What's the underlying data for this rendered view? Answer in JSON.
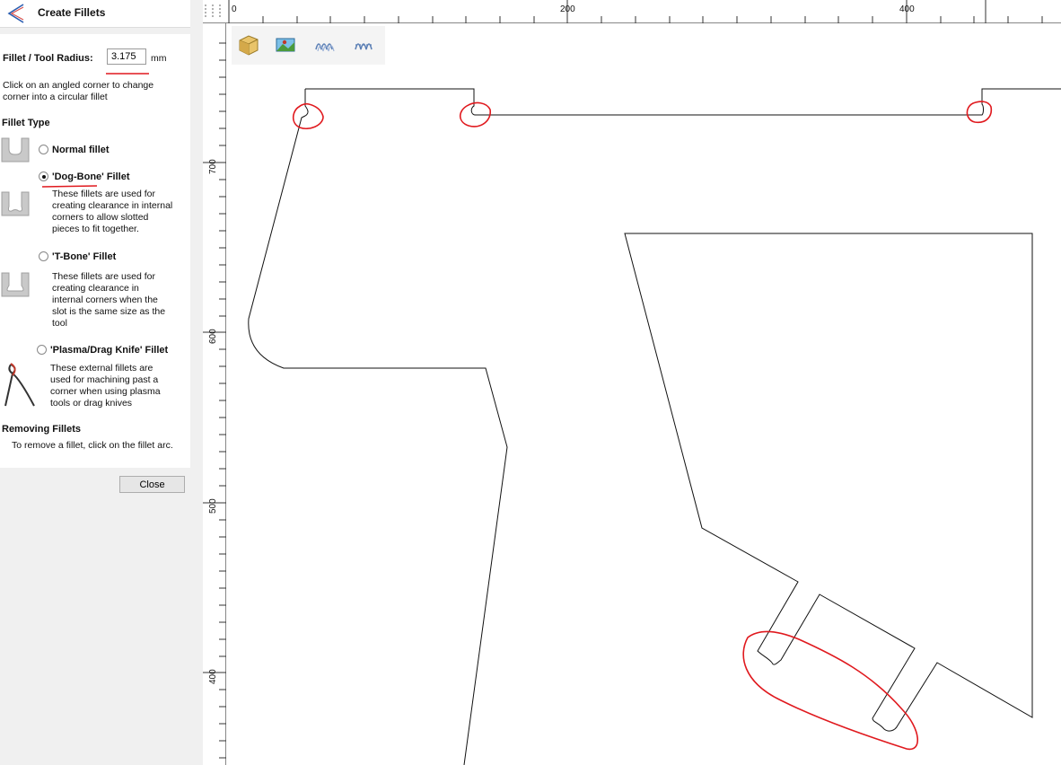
{
  "panel": {
    "title": "Create Fillets",
    "radius_label": "Fillet / Tool Radius:",
    "radius_value": "3.175",
    "radius_unit": "mm",
    "instructions": [
      "Click on an angled corner to change",
      "corner into a circular fillet"
    ],
    "fillet_type_heading": "Fillet Type",
    "options": [
      {
        "label": "Normal fillet",
        "checked": false,
        "description": []
      },
      {
        "label": "'Dog-Bone' Fillet",
        "checked": true,
        "description": [
          "These fillets are used for",
          "creating clearance in internal",
          "corners to allow slotted",
          "pieces to fit together."
        ]
      },
      {
        "label": "'T-Bone' Fillet",
        "checked": false,
        "description": [
          "These fillets are used for",
          "creating clearance in",
          "internal corners when the",
          "slot is the same size as the",
          "tool"
        ]
      },
      {
        "label": "'Plasma/Drag Knife' Fillet",
        "checked": false,
        "description": [
          "These external fillets are",
          "used for machining past a",
          "corner when using plasma",
          "tools or drag knives"
        ]
      }
    ],
    "removing_heading": "Removing Fillets",
    "removing_text": "To remove a fillet, click on the fillet arc.",
    "close_label": "Close"
  },
  "ruler": {
    "h_labels": [
      "0",
      "200",
      "400"
    ],
    "v_labels": [
      "700",
      "600",
      "500",
      "400"
    ]
  },
  "toolbar": {
    "icons": [
      "3d-view-icon",
      "render-image-icon",
      "toolpath-icon",
      "toolpath-simulation-icon"
    ]
  },
  "colors": {
    "annotation": "#e0191e",
    "accent": "#d9534f",
    "line": "#111111"
  }
}
